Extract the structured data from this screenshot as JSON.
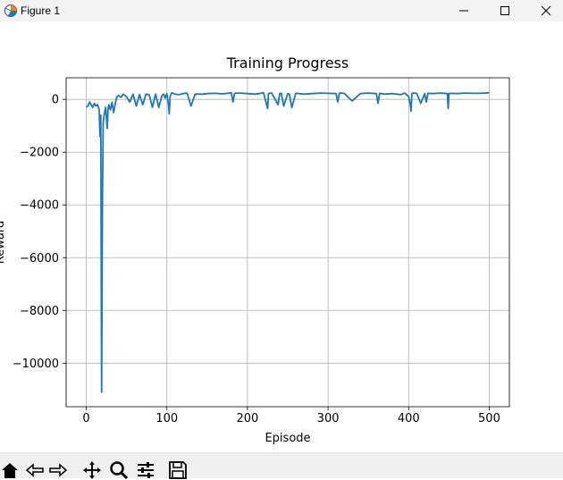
{
  "window": {
    "title": "Figure 1"
  },
  "chart_data": {
    "type": "line",
    "title": "Training Progress",
    "xlabel": "Episode",
    "ylabel": "Reward",
    "xlim": [
      -25,
      525
    ],
    "ylim": [
      -11650,
      820
    ],
    "xticks": [
      0,
      100,
      200,
      300,
      400,
      500
    ],
    "yticks": [
      0,
      -2000,
      -4000,
      -6000,
      -8000,
      -10000
    ],
    "ytick_labels": [
      "0",
      "−2000",
      "−4000",
      "−6000",
      "−8000",
      "−10000"
    ],
    "grid": true,
    "line_color": "#1f77b4",
    "series": [
      {
        "x": [
          0,
          2,
          4,
          6,
          8,
          10,
          12,
          14,
          16,
          17,
          18,
          19,
          20,
          21,
          22,
          24,
          26,
          27,
          28,
          30,
          32,
          34,
          36,
          38,
          40,
          43,
          46,
          50,
          54,
          58,
          62,
          66,
          70,
          74,
          78,
          82,
          86,
          90,
          94,
          96,
          98,
          100,
          102,
          103,
          104,
          106,
          110,
          115,
          120,
          125,
          130,
          135,
          136,
          137,
          140,
          145,
          150,
          160,
          170,
          180,
          182,
          184,
          190,
          200,
          210,
          220,
          225,
          226,
          227,
          230,
          238,
          240,
          242,
          245,
          250,
          252,
          255,
          260,
          270,
          280,
          290,
          300,
          310,
          312,
          314,
          320,
          330,
          340,
          350,
          360,
          362,
          364,
          370,
          380,
          390,
          395,
          400,
          402,
          403,
          404,
          405,
          410,
          415,
          420,
          422,
          424,
          430,
          440,
          448,
          449,
          450,
          452,
          460,
          470,
          480,
          490,
          500
        ],
        "y": [
          -300,
          -250,
          -100,
          -200,
          -300,
          -150,
          -250,
          -200,
          -400,
          -1400,
          -600,
          -11100,
          -4000,
          -900,
          -600,
          -300,
          -1100,
          -400,
          -200,
          -400,
          -100,
          -500,
          -150,
          100,
          150,
          80,
          200,
          100,
          -100,
          200,
          -250,
          180,
          -200,
          200,
          180,
          -300,
          200,
          -300,
          150,
          200,
          50,
          220,
          -200,
          -550,
          100,
          250,
          200,
          180,
          220,
          240,
          -250,
          200,
          180,
          210,
          200,
          200,
          220,
          230,
          210,
          250,
          -100,
          230,
          240,
          220,
          200,
          250,
          -350,
          220,
          230,
          240,
          -200,
          220,
          230,
          -250,
          220,
          200,
          -300,
          230,
          200,
          220,
          240,
          230,
          220,
          -100,
          240,
          230,
          -60,
          220,
          240,
          220,
          -150,
          230,
          200,
          220,
          180,
          240,
          100,
          -200,
          -450,
          220,
          240,
          230,
          -150,
          220,
          -100,
          230,
          220,
          240,
          220,
          -350,
          220,
          230,
          220,
          240,
          230,
          230,
          250
        ]
      }
    ]
  }
}
